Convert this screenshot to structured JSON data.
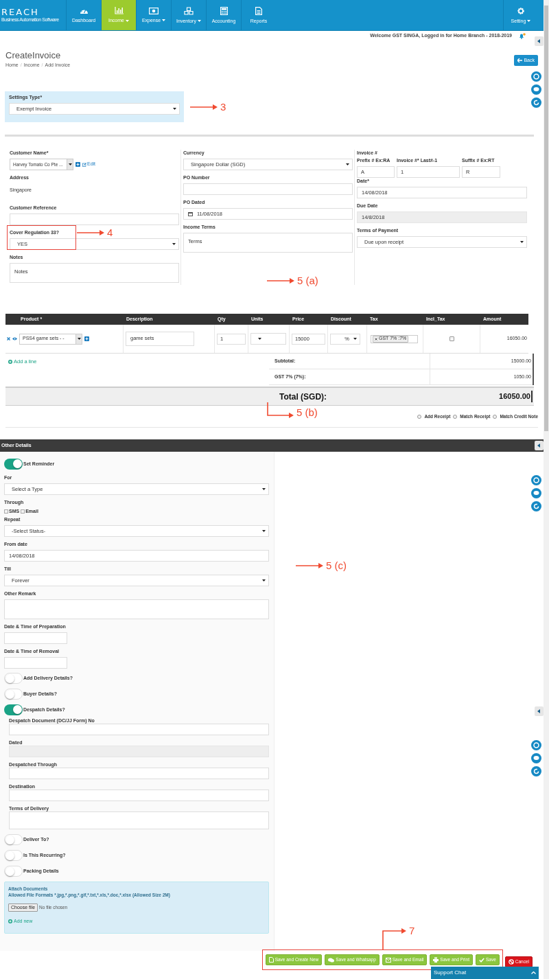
{
  "nav": {
    "logo": {
      "title": "REACH",
      "subtitle": "Business Automation Software"
    },
    "items": [
      {
        "label": "Dashboard",
        "dropdown": false,
        "selected": false
      },
      {
        "label": "Income",
        "dropdown": true,
        "selected": true
      },
      {
        "label": "Expense",
        "dropdown": true,
        "selected": false
      },
      {
        "label": "Inventory",
        "dropdown": true,
        "selected": false
      },
      {
        "label": "Accounting",
        "dropdown": false,
        "selected": false
      },
      {
        "label": "Reports",
        "dropdown": false,
        "selected": false
      }
    ],
    "settings": {
      "label": "Setting",
      "dropdown": true
    }
  },
  "welcome": "Welcome GST SINGA, Logged in for Home Branch - 2018-2019",
  "page": {
    "title": "CreateInvoice",
    "breadcrumb": [
      {
        "kind": "link",
        "text": "Home"
      },
      {
        "kind": "separator",
        "text": "/"
      },
      {
        "kind": "link",
        "text": "Income"
      },
      {
        "kind": "separator",
        "text": "/"
      },
      {
        "kind": "current",
        "text": "Add Invoice"
      }
    ],
    "back": "Back"
  },
  "settings_type": {
    "label": "Settings Type*",
    "value": "Exempt Invoice",
    "annotation": {
      "kind": "arrow",
      "label": "3"
    }
  },
  "form": {
    "annotation": {
      "kind": "arrow",
      "label": "5 (a)"
    },
    "columns": [
      [
        {
          "kind": "customer",
          "label": "Customer Name*",
          "value": "Harvey Tomato Co Pte ...",
          "edit": "Edit"
        },
        {
          "kind": "static",
          "label": "Address",
          "value": "Singapore"
        },
        {
          "kind": "input",
          "label": "Customer Reference"
        },
        {
          "kind": "select",
          "label": "Cover Regulation 33?",
          "value": "YES",
          "highlighted": true,
          "annotation": {
            "kind": "arrow",
            "label": "4"
          }
        },
        {
          "kind": "textarea",
          "label": "Notes",
          "value": "Notes"
        }
      ],
      [
        {
          "kind": "select",
          "label": "Currency",
          "value": "Singapore Dollar (SGD)"
        },
        {
          "kind": "input",
          "label": "PO Number"
        },
        {
          "kind": "date",
          "label": "PO Dated",
          "value": "11/08/2018"
        },
        {
          "kind": "textarea",
          "label": "Income Terms",
          "value": "Terms"
        }
      ],
      [
        {
          "kind": "invoice_number",
          "label": "Invoice #",
          "parts": [
            {
              "label": "Prefix # Ex:RA",
              "value": "A"
            },
            {
              "label": "Invoice #* Last#-1",
              "value": "1"
            },
            {
              "label": "Suffix # Ex:RT",
              "value": "R"
            }
          ]
        },
        {
          "kind": "input",
          "label": "Date*",
          "value": "14/08/2018"
        },
        {
          "kind": "disabled",
          "label": "Due Date",
          "value": "14/8/2018"
        },
        {
          "kind": "select",
          "label": "Terms of Payment",
          "value": "Due upon receipt"
        }
      ]
    ]
  },
  "line_items": {
    "columns": [
      "Product *",
      "Description",
      "Qty",
      "Units",
      "Price",
      "Discount",
      "Tax",
      "Incl_Tax",
      "Amount"
    ],
    "rows": [
      {
        "product": "PSS4 game sets - -",
        "description": "game sets",
        "qty": "1",
        "price": "15000",
        "discount": "%",
        "tax": "GST 7% :7%",
        "incl_tax": false,
        "amount": "16050.00"
      }
    ],
    "add_line": "Add a line",
    "summary": [
      {
        "label": "Subtotal:",
        "value": "15000.00"
      },
      {
        "label": "GST 7% (7%):",
        "value": "1050.00"
      }
    ],
    "total": {
      "label": "Total (SGD):",
      "value": "16050.00"
    },
    "annotation": {
      "kind": "elbow_down",
      "label": "5 (b)"
    },
    "options": [
      {
        "label": "Add Receipt",
        "selected": false
      },
      {
        "label": "Match Receipt",
        "selected": false
      },
      {
        "label": "Match Credit Note",
        "selected": false
      }
    ]
  },
  "other_details": {
    "title": "Other Details",
    "annotation": {
      "kind": "arrow",
      "label": "5 (c)"
    },
    "items": [
      {
        "kind": "toggle",
        "label": "Set Reminder",
        "on": true
      },
      {
        "kind": "select",
        "label": "For",
        "value": "Select a Type"
      },
      {
        "kind": "checks",
        "label": "Through",
        "options": [
          {
            "label": "SMS",
            "checked": false
          },
          {
            "label": "Email",
            "checked": false
          }
        ]
      },
      {
        "kind": "select",
        "label": "Repeat",
        "value": "-Select Status-"
      },
      {
        "kind": "input",
        "label": "From date",
        "value": "14/08/2018"
      },
      {
        "kind": "select",
        "label": "Till",
        "value": "Forever"
      },
      {
        "kind": "textarea",
        "label": "Other Remark"
      },
      {
        "kind": "small_input",
        "label": "Date & Time of Preparation"
      },
      {
        "kind": "small_input",
        "label": "Date & Time of Removal"
      },
      {
        "kind": "toggle",
        "label": "Add Delivery Details?",
        "on": false
      },
      {
        "kind": "toggle",
        "label": "Buyer Details?",
        "on": false
      },
      {
        "kind": "toggle",
        "label": "Despatch Details?",
        "on": true,
        "children": [
          {
            "kind": "input",
            "label": "Despatch Document (DC/JJ Form) No"
          },
          {
            "kind": "disabled",
            "label": "Dated"
          },
          {
            "kind": "input",
            "label": "Despatched Through"
          },
          {
            "kind": "input",
            "label": "Destination"
          },
          {
            "kind": "textarea",
            "label": "Terms of Delivery"
          }
        ]
      },
      {
        "kind": "toggle",
        "label": "Deliver To?",
        "on": false
      },
      {
        "kind": "toggle",
        "label": "Is This Recurring?",
        "on": false
      },
      {
        "kind": "toggle",
        "label": "Packing Details",
        "on": false
      },
      {
        "kind": "upload",
        "title": "Attach Documents",
        "formats": "Allowed File Formats *.jpg,*.png,*.gif,*.txt,*.xls,*.doc,*.xlsx (Allowed Size 2M)",
        "button": "Choose file",
        "status": "No file chosen",
        "add": "Add new"
      }
    ]
  },
  "actions": {
    "highlighted": true,
    "annotation": {
      "kind": "elbow_up",
      "label": "7"
    },
    "save_buttons": [
      "Save and Create New",
      "Save and Whatsapp",
      "Save and Email",
      "Save and Print",
      "Save"
    ],
    "cancel": "Cancel"
  },
  "support_chat": "Support Chat"
}
